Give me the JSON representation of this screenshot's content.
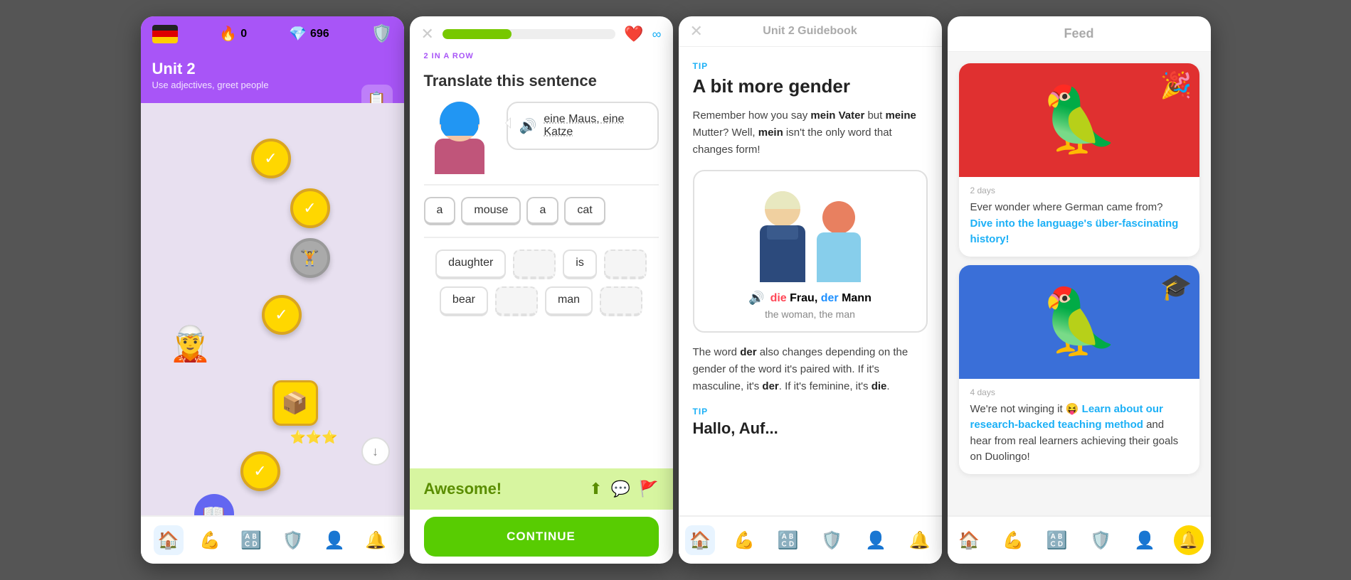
{
  "screen1": {
    "flag": "DE",
    "streak": "0",
    "gems": "696",
    "unit_title": "Unit 2",
    "unit_subtitle": "Use adjectives, greet people",
    "bottom_nav": [
      "🏠",
      "💪",
      "🔠",
      "🛡️",
      "👤",
      "🔔"
    ]
  },
  "screen2": {
    "streak_label": "2 IN A ROW",
    "progress_pct": 40,
    "title": "Translate this sentence",
    "german_text": "eine Maus, eine Katze",
    "answer_words": [
      "a",
      "mouse",
      "a",
      "cat"
    ],
    "word_bank": [
      "daughter",
      "",
      "is",
      "",
      "bear",
      "",
      "man",
      ""
    ],
    "feedback_text": "Awesome!",
    "continue_label": "CONTINUE"
  },
  "screen3": {
    "title": "Unit 2 Guidebook",
    "tip1_label": "TIP",
    "tip1_title": "A bit more gender",
    "tip1_body1": "Remember how you say ",
    "tip1_bold1": "mein Vater",
    "tip1_body2": " but ",
    "tip1_bold2": "meine",
    "tip1_body3": " Mutter? Well, ",
    "tip1_bold3": "mein",
    "tip1_body4": " isn't the only word that changes form!",
    "caption_die": "die",
    "caption_frau": " Frau, ",
    "caption_der": "der",
    "caption_mann": " Mann",
    "caption_translation": "the woman, the man",
    "body2": "The word ",
    "bold4": "der",
    "body2b": " also changes depending on the gender of the word it's paired with. If it's masculine, it's ",
    "bold5": "der",
    "body2c": ". If it's feminine, it's ",
    "bold6": "die",
    "tip2_label": "TIP",
    "tip2_partial": "Hallo, Auf..."
  },
  "screen4": {
    "title": "Feed",
    "card1": {
      "days": "2 days",
      "text": "Ever wonder where German came from? ",
      "link": "Dive into the language's über-fascinating history!"
    },
    "card2": {
      "days": "4 days",
      "text": "We're not winging it 😝 ",
      "link": "Learn about our research-backed teaching method",
      "text2": " and hear from real learners achieving their goals on Duolingo!"
    },
    "bottom_nav": [
      "🏠",
      "💪",
      "🔠",
      "🛡️",
      "👤",
      "🔔"
    ]
  }
}
